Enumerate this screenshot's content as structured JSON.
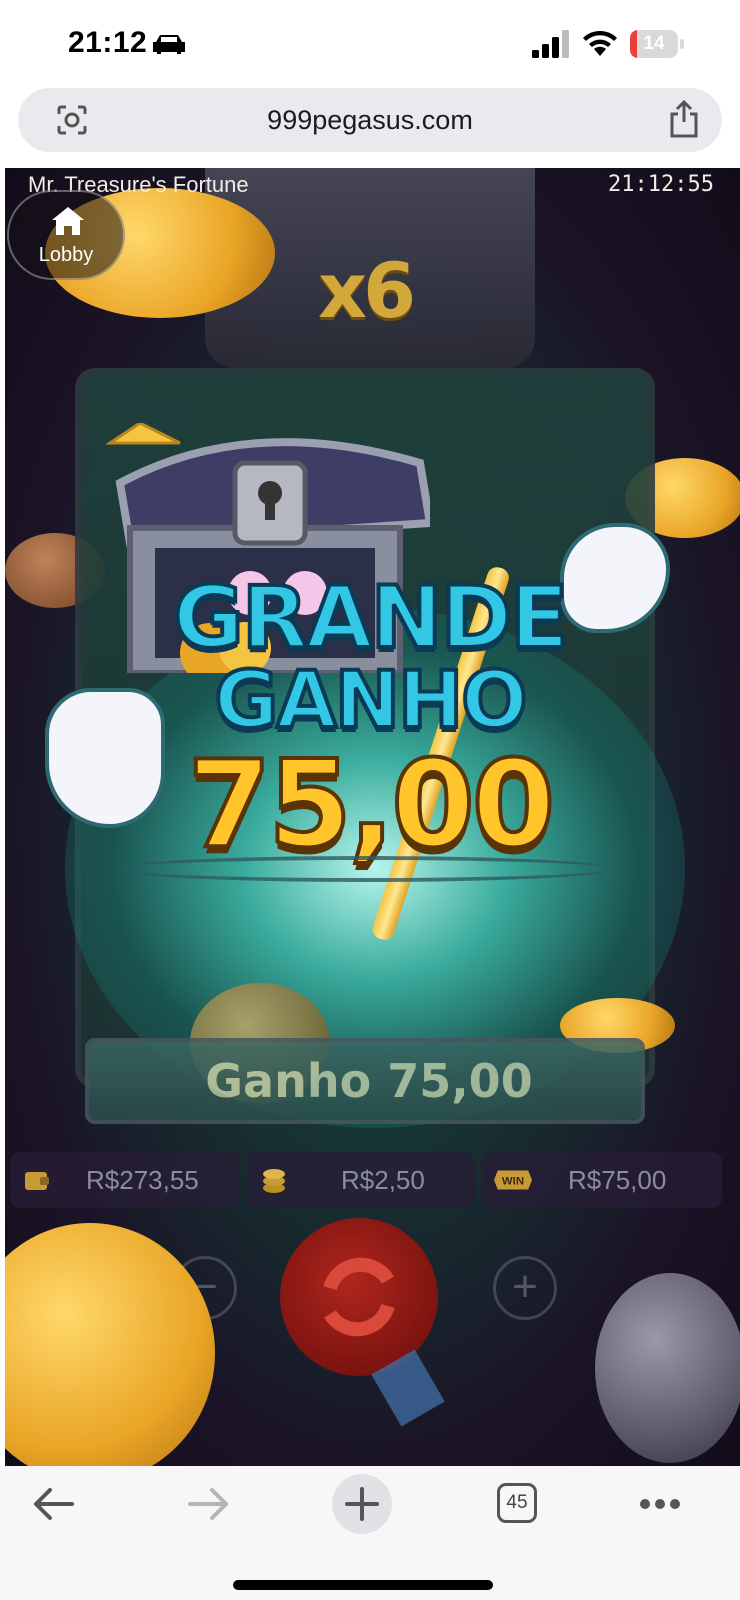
{
  "status_bar": {
    "time": "21:12",
    "battery": "14",
    "battery_percent": 14,
    "car_icon": "car-icon",
    "signal_icon": "cellular-signal-icon",
    "wifi_icon": "wifi-icon"
  },
  "browser": {
    "url": "999pegasus.com",
    "lens_icon": "camera-lens-icon",
    "share_icon": "share-icon"
  },
  "game": {
    "title": "Mr. Treasure's Fortune",
    "clock": "21:12:55",
    "lobby_label": "Lobby",
    "multiplier": "x6",
    "win_line1": "GRANDE",
    "win_line2": "GANHO",
    "win_amount": "75,00",
    "total_win_text": "Ganho 75,00",
    "balance": "R$273,55",
    "bet": "R$2,50",
    "win": "R$75,00",
    "minus_label": "−",
    "plus_label": "+"
  },
  "toolbar": {
    "tabs_count": "45"
  },
  "colors": {
    "win_text_accent": "#33c7e6",
    "win_amount": "#ffc52a",
    "battery_low": "#e8413a"
  }
}
